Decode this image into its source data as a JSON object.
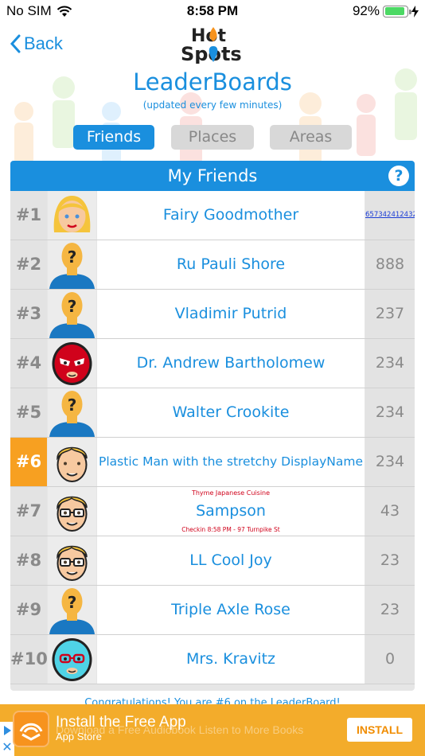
{
  "status": {
    "carrier": "No SIM",
    "time": "8:58 PM",
    "battery": "92%",
    "battery_level": 0.92
  },
  "header": {
    "back_label": "Back",
    "logo_line1": "Hot",
    "logo_line2": "Spots",
    "title": "LeaderBoards",
    "subtitle": "(updated every few minutes)"
  },
  "tabs": [
    {
      "label": "Friends",
      "active": true
    },
    {
      "label": "Places",
      "active": false
    },
    {
      "label": "Areas",
      "active": false
    }
  ],
  "panel": {
    "title": "My Friends",
    "help_label": "?"
  },
  "rows": [
    {
      "rank": "#1",
      "name": "Fairy Goodmother",
      "score": "657342412432",
      "avatar": "blonde-woman"
    },
    {
      "rank": "#2",
      "name": "Ru Pauli Shore",
      "score": "888",
      "avatar": "unknown"
    },
    {
      "rank": "#3",
      "name": "Vladimir Putrid",
      "score": "237",
      "avatar": "unknown"
    },
    {
      "rank": "#4",
      "name": "Dr. Andrew Bartholomew",
      "score": "234",
      "avatar": "red-wrestler"
    },
    {
      "rank": "#5",
      "name": "Walter Crookite",
      "score": "234",
      "avatar": "unknown"
    },
    {
      "rank": "#6",
      "name": "Plastic Man with the stretchy DisplayName",
      "score": "234",
      "avatar": "blond-man"
    },
    {
      "rank": "#7",
      "name": "Sampson",
      "score": "43",
      "avatar": "glasses-man",
      "place": "Thyme Japanese Cuisine",
      "checkin": "Checkin 8:58 PM - 97 Turnpike St"
    },
    {
      "rank": "#8",
      "name": "LL Cool Joy",
      "score": "23",
      "avatar": "glasses-man"
    },
    {
      "rank": "#9",
      "name": "Triple Axle Rose",
      "score": "23",
      "avatar": "unknown"
    },
    {
      "rank": "#10",
      "name": "Mrs. Kravitz",
      "score": "0",
      "avatar": "cyan-wrestler"
    }
  ],
  "congrats": "Congratulations! You are #6 on the LeaderBoard!",
  "ad": {
    "title": "Install the Free App",
    "store": "App Store",
    "ghost": "Download a Free Audiobook Listen to More Books",
    "install_label": "INSTALL",
    "icon": "audible-icon"
  },
  "colors": {
    "accent": "#1a8fde",
    "highlight": "#f7a021",
    "ad_bg": "#f3ac2b"
  }
}
